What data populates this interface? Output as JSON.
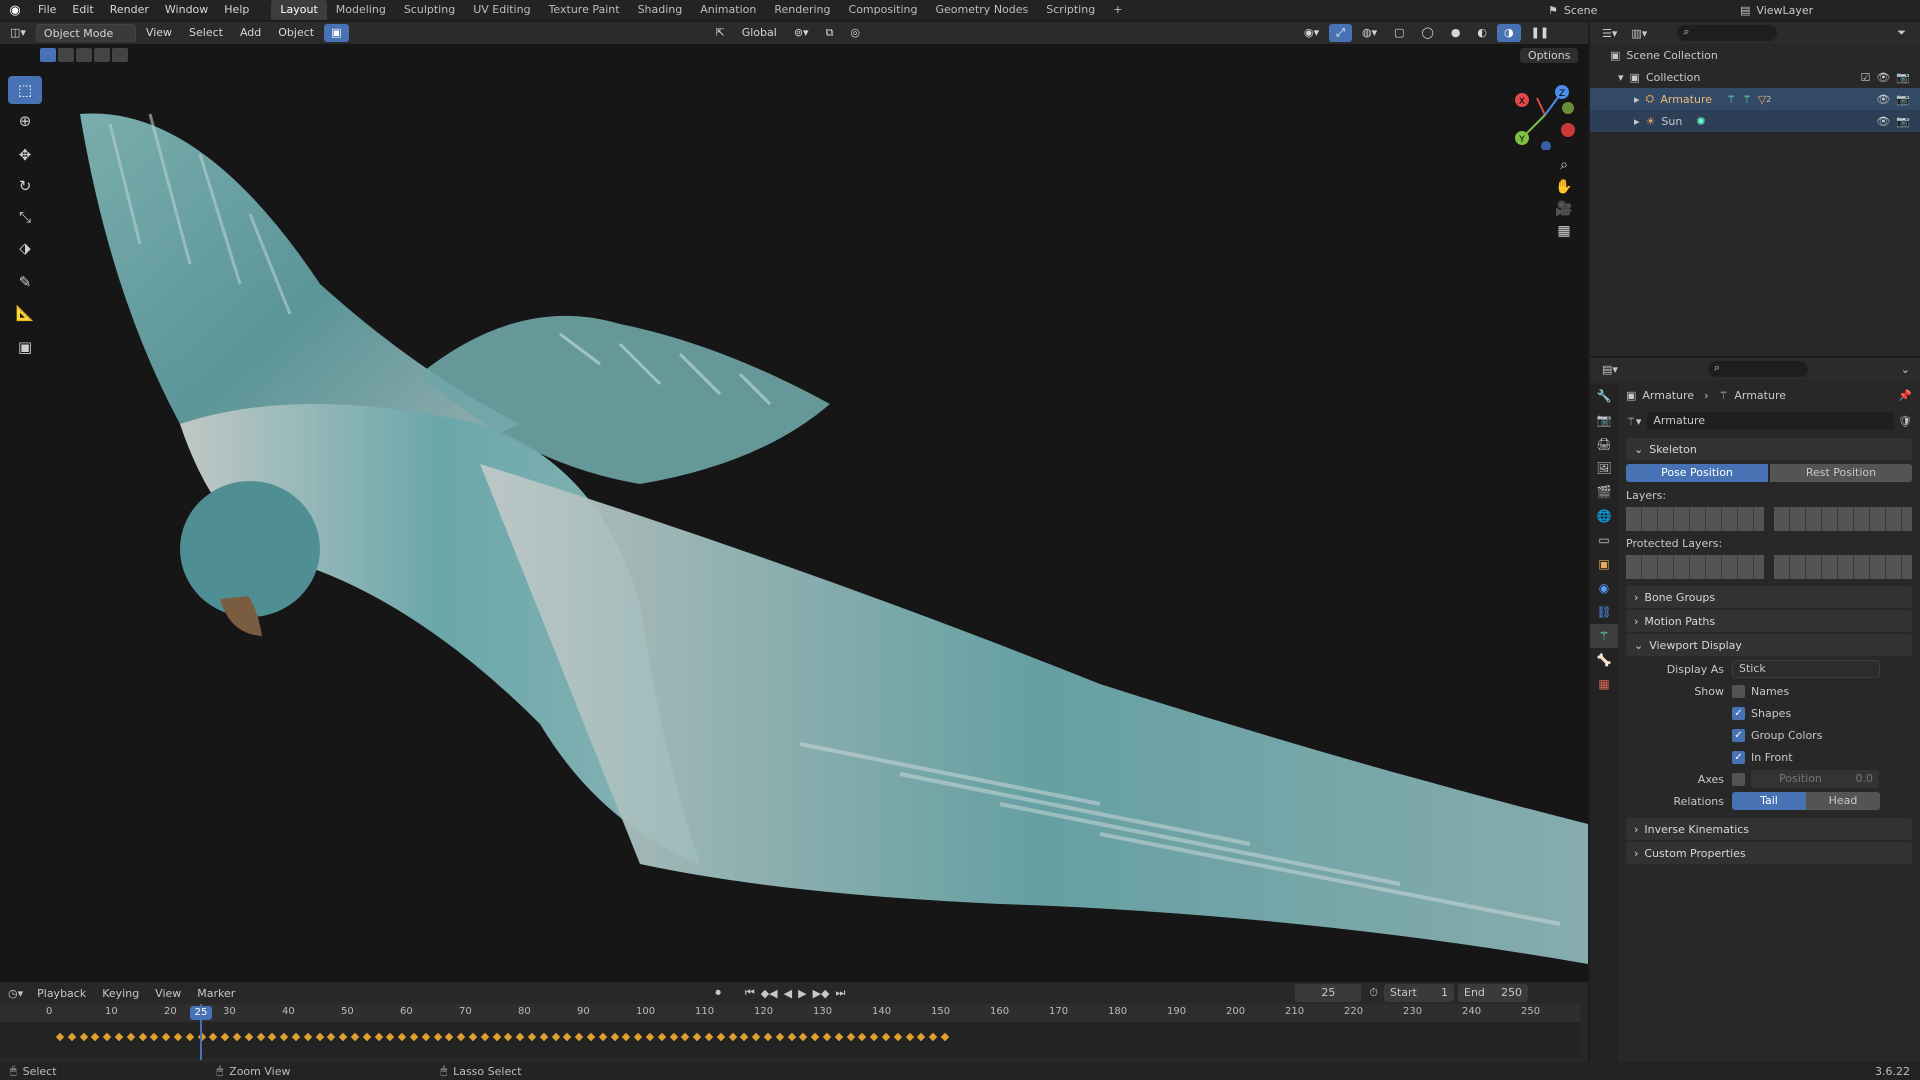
{
  "topbar": {
    "menus": [
      "File",
      "Edit",
      "Render",
      "Window",
      "Help"
    ],
    "workspaces": [
      "Layout",
      "Modeling",
      "Sculpting",
      "UV Editing",
      "Texture Paint",
      "Shading",
      "Animation",
      "Rendering",
      "Compositing",
      "Geometry Nodes",
      "Scripting"
    ],
    "active_workspace": "Layout",
    "scene": "Scene",
    "viewlayer": "ViewLayer"
  },
  "viewport_header": {
    "mode": "Object Mode",
    "menus": [
      "View",
      "Select",
      "Add",
      "Object"
    ],
    "orientation": "Global",
    "options": "Options"
  },
  "gizmo": {
    "x": "X",
    "y": "Y",
    "z": "Z"
  },
  "outliner": {
    "scene_collection": "Scene Collection",
    "collection": "Collection",
    "items": [
      "Armature",
      "Sun"
    ],
    "armature_badge": "2"
  },
  "properties": {
    "breadcrumb_object": "Armature",
    "breadcrumb_data": "Armature",
    "datablock_name": "Armature",
    "skeleton": "Skeleton",
    "pose_position": "Pose Position",
    "rest_position": "Rest Position",
    "layers": "Layers:",
    "protected_layers": "Protected Layers:",
    "bone_groups": "Bone Groups",
    "motion_paths": "Motion Paths",
    "viewport_display": "Viewport Display",
    "display_as_label": "Display As",
    "display_as_value": "Stick",
    "show_label": "Show",
    "show_items": [
      {
        "label": "Names",
        "checked": false
      },
      {
        "label": "Shapes",
        "checked": true
      },
      {
        "label": "Group Colors",
        "checked": true
      },
      {
        "label": "In Front",
        "checked": true
      }
    ],
    "axes_label": "Axes",
    "axes_position": "Position",
    "axes_value": "0.0",
    "relations_label": "Relations",
    "relations_tail": "Tail",
    "relations_head": "Head",
    "inverse_kinematics": "Inverse Kinematics",
    "custom_properties": "Custom Properties"
  },
  "timeline": {
    "menus": [
      "Playback",
      "Keying",
      "View",
      "Marker"
    ],
    "current_frame": "25",
    "start_label": "Start",
    "start_value": "1",
    "end_label": "End",
    "end_value": "250",
    "ticks": [
      "0",
      "10",
      "20",
      "30",
      "40",
      "50",
      "60",
      "70",
      "80",
      "90",
      "100",
      "110",
      "120",
      "130",
      "140",
      "150",
      "160",
      "170",
      "180",
      "190",
      "200",
      "210",
      "220",
      "230",
      "240",
      "250"
    ]
  },
  "status": {
    "select": "Select",
    "zoom": "Zoom View",
    "lasso": "Lasso Select",
    "version": "3.6.22"
  },
  "colors": {
    "accent": "#4772b3",
    "keyframe": "#e0a030",
    "bg": "#161616"
  }
}
